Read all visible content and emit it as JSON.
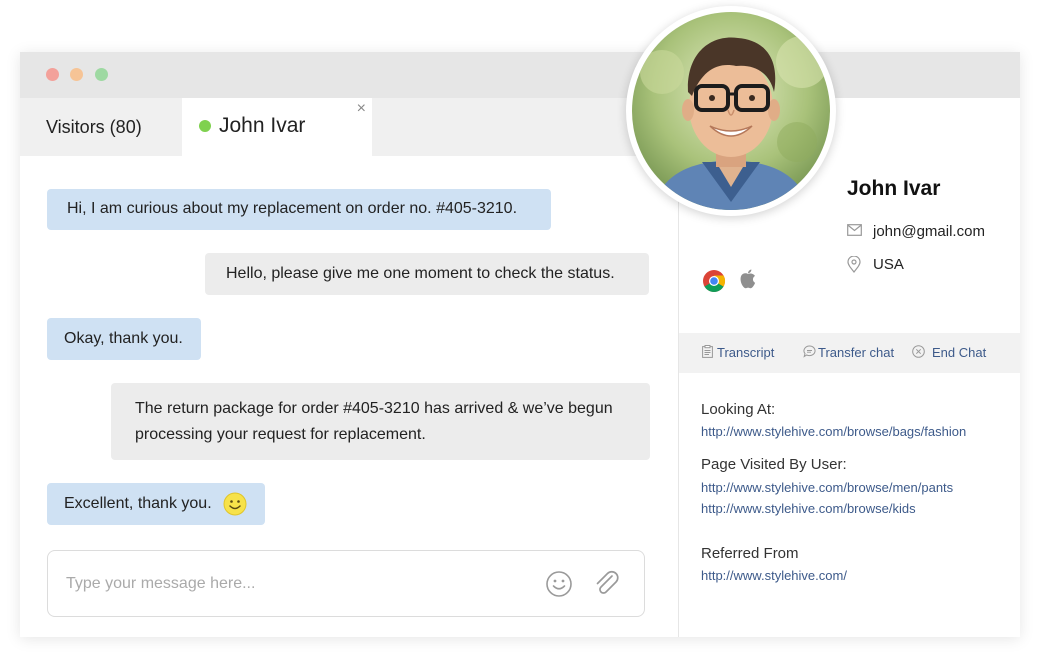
{
  "tabs": {
    "visitors_label": "Visitors (80)",
    "active_label": "John Ivar",
    "close_glyph": "×"
  },
  "messages": [
    {
      "from": "visitor",
      "text": "Hi, I am curious about my replacement on order no. #405-3210."
    },
    {
      "from": "agent",
      "text": "Hello, please give me one moment to check the status."
    },
    {
      "from": "visitor",
      "text": "Okay, thank you."
    },
    {
      "from": "agent",
      "line1": "The return package for order #405-3210 has arrived & we’ve begun",
      "line2": "processing your request for replacement."
    },
    {
      "from": "visitor",
      "text": "Excellent, thank you.",
      "icon": "smiley-emoji-icon"
    }
  ],
  "composer": {
    "placeholder": "Type your message here...",
    "value": "",
    "emoji_icon": "smiley-icon",
    "attach_icon": "paperclip-icon"
  },
  "visitor": {
    "name": "John Ivar",
    "email": "john@gmail.com",
    "country": "USA",
    "browser_icon": "chrome-icon",
    "os_icon": "apple-icon"
  },
  "actions": {
    "transcript": "Transcript",
    "transfer": "Transfer chat",
    "end": "End Chat"
  },
  "details": {
    "looking_at_label": "Looking At:",
    "looking_at_url": "http://www.stylehive.com/browse/bags/fashion",
    "visited_label": "Page Visited By User:",
    "visited_urls": [
      "http://www.stylehive.com/browse/men/pants",
      "http://www.stylehive.com/browse/kids"
    ],
    "referred_label": "Referred From",
    "referred_url": "http://www.stylehive.com/"
  },
  "colors": {
    "visitor_bubble": "#cfe1f3",
    "agent_bubble": "#ececec",
    "online_dot": "#7fd14f",
    "link": "#3d5a8a"
  }
}
